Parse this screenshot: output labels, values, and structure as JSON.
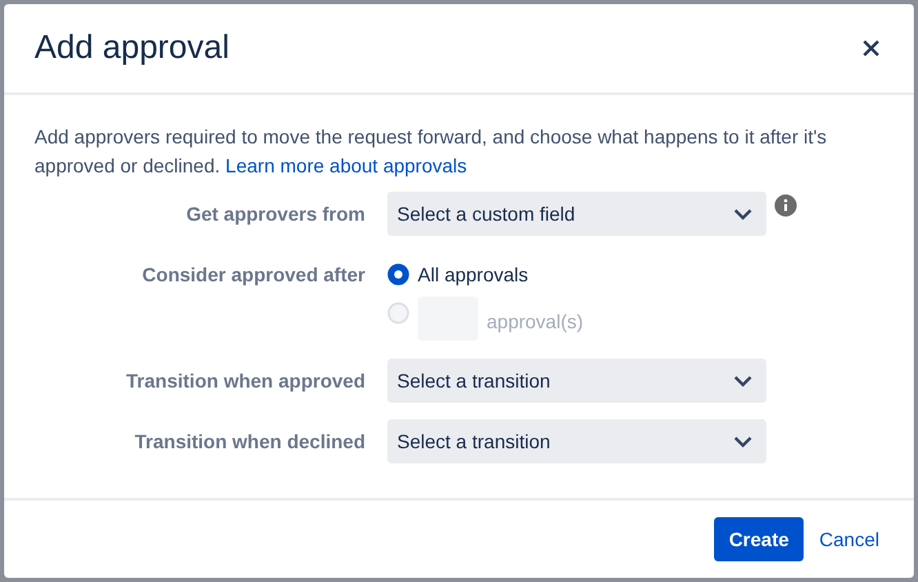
{
  "dialog": {
    "title": "Add approval",
    "description": "Add approvers required to move the request forward, and choose what happens to it after it's approved or declined.",
    "link": "Learn more about approvals",
    "fields": [
      {
        "kind": "select",
        "label": "Get approvers from",
        "placeholder": "Select a custom field",
        "info": true
      },
      {
        "kind": "radio",
        "label": "Consider approved after",
        "options": [
          {
            "kind": "text",
            "label": "All approvals",
            "selected": true,
            "disabled": false
          },
          {
            "kind": "count",
            "suffix": "approval(s)",
            "selected": false,
            "disabled": true
          }
        ]
      },
      {
        "kind": "select",
        "label": "Transition when approved",
        "placeholder": "Select a transition",
        "info": false
      },
      {
        "kind": "select",
        "label": "Transition when declined",
        "placeholder": "Select a transition",
        "info": false
      }
    ],
    "buttons": [
      {
        "kind": "primary",
        "label": "Create"
      },
      {
        "kind": "link",
        "label": "Cancel"
      }
    ]
  }
}
